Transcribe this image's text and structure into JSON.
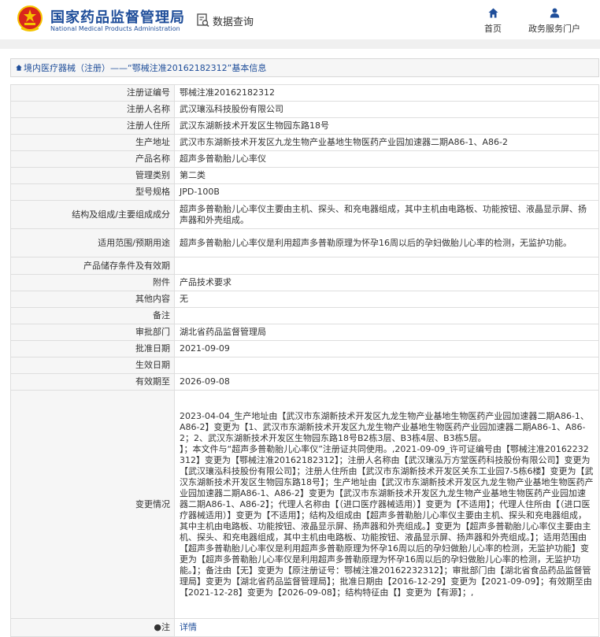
{
  "header": {
    "site_name_cn": "国家药品监督管理局",
    "site_name_en": "National Medical Products Administration",
    "section": "数据查询",
    "nav": [
      {
        "label": "首页",
        "icon": "home-icon"
      },
      {
        "label": "政务服务门户",
        "icon": "user-icon"
      }
    ]
  },
  "breadcrumb": {
    "text": "境内医疗器械（注册）——“鄂械注准20162182312”基本信息"
  },
  "colors": {
    "brand_blue": "#1f4e9a",
    "emblem_red": "#d9261c",
    "emblem_gold": "#f5c400"
  },
  "fields": [
    {
      "label": "注册证编号",
      "value": "鄂械注准20162182312"
    },
    {
      "label": "注册人名称",
      "value": "武汉瓖泓科技股份有限公司"
    },
    {
      "label": "注册人住所",
      "value": "武汉东湖新技术开发区生物园东路18号"
    },
    {
      "label": "生产地址",
      "value": "武汉市东湖新技术开发区九龙生物产业基地生物医药产业园加速器二期A86-1、A86-2"
    },
    {
      "label": "产品名称",
      "value": "超声多普勒胎儿心率仪"
    },
    {
      "label": "管理类别",
      "value": "第二类"
    },
    {
      "label": "型号规格",
      "value": "JPD-100B"
    },
    {
      "label": "结构及组成/主要组成成分",
      "value": "超声多普勒胎儿心率仪主要由主机、探头、和充电器组成，其中主机由电路板、功能按钮、液晶显示屏、扬声器和外壳组成。"
    },
    {
      "label": "适用范围/预期用途",
      "value": "超声多普勒胎儿心率仪是利用超声多普勒原理为怀孕16周以后的孕妇做胎儿心率的检测，无监护功能。"
    },
    {
      "label": "产品储存条件及有效期",
      "value": ""
    },
    {
      "label": "附件",
      "value": "产品技术要求"
    },
    {
      "label": "其他内容",
      "value": "无"
    },
    {
      "label": "备注",
      "value": ""
    },
    {
      "label": "审批部门",
      "value": "湖北省药品监督管理局"
    },
    {
      "label": "批准日期",
      "value": "2021-09-09"
    },
    {
      "label": "生效日期",
      "value": ""
    },
    {
      "label": "有效期至",
      "value": "2026-09-08"
    },
    {
      "label": "变更情况",
      "value": "2023-04-04_生产地址由【武汉市东湖新技术开发区九龙生物产业基地生物医药产业园加速器二期A86-1、A86-2】变更为【1、武汉市东湖新技术开发区九龙生物产业基地生物医药产业园加速器二期A86-1、A86-2；2、武汉东湖新技术开发区生物园东路18号B2栋3层、B3栋4层、B3栋5层。\n】；本文件与“超声多普勒胎儿心率仪”注册证共同使用。,2021-09-09_许可证编号由【鄂械注准20162232312】变更为【鄂械注准20162182312】；注册人名称由【武汉瓖泓万方堂医药科技股份有限公司】变更为【武汉瓖泓科技股份有限公司】；注册人住所由【武汉市东湖新技术开发区关东工业园7-5栋6楼】变更为【武汉东湖新技术开发区生物园东路18号】；生产地址由【武汉市东湖新技术开发区九龙生物产业基地生物医药产业园加速器二期A86-1、A86-2】变更为【武汉市东湖新技术开发区九龙生物产业基地生物医药产业园加速器二期A86-1、A86-2】；代理人名称由【（进口医疗器械适用）】变更为【不适用】；代理人住所由【（进口医疗器械适用）】变更为【不适用】；结构及组成由【超声多普勒胎儿心率仪主要由主机、探头和充电器组成，其中主机由电路板、功能按钮、液晶显示屏、扬声器和外壳组成。】变更为【超声多普勒胎儿心率仪主要由主机、探头、和充电器组成，其中主机由电路板、功能按钮、液晶显示屏、扬声器和外壳组成。】；适用范围由【超声多普勒胎儿心率仪是利用超声多普勒原理为怀孕16周以后的孕妇做胎儿心率的检测，无监护功能】变更为【超声多普勒胎儿心率仪是利用超声多普勒原理为怀孕16周以后的孕妇做胎儿心率的检测，无监护功能。】；备注由【无】变更为【原注册证号：鄂械注准20162232312】；审批部门由【湖北省食品药品监督管理局】变更为【湖北省药品监督管理局】；批准日期由【2016-12-29】变更为【2021-09-09】；有效期至由【2021-12-28】变更为【2026-09-08】；结构特征由【】变更为【有源】；,"
    },
    {
      "label": "注",
      "value": "详情"
    }
  ]
}
